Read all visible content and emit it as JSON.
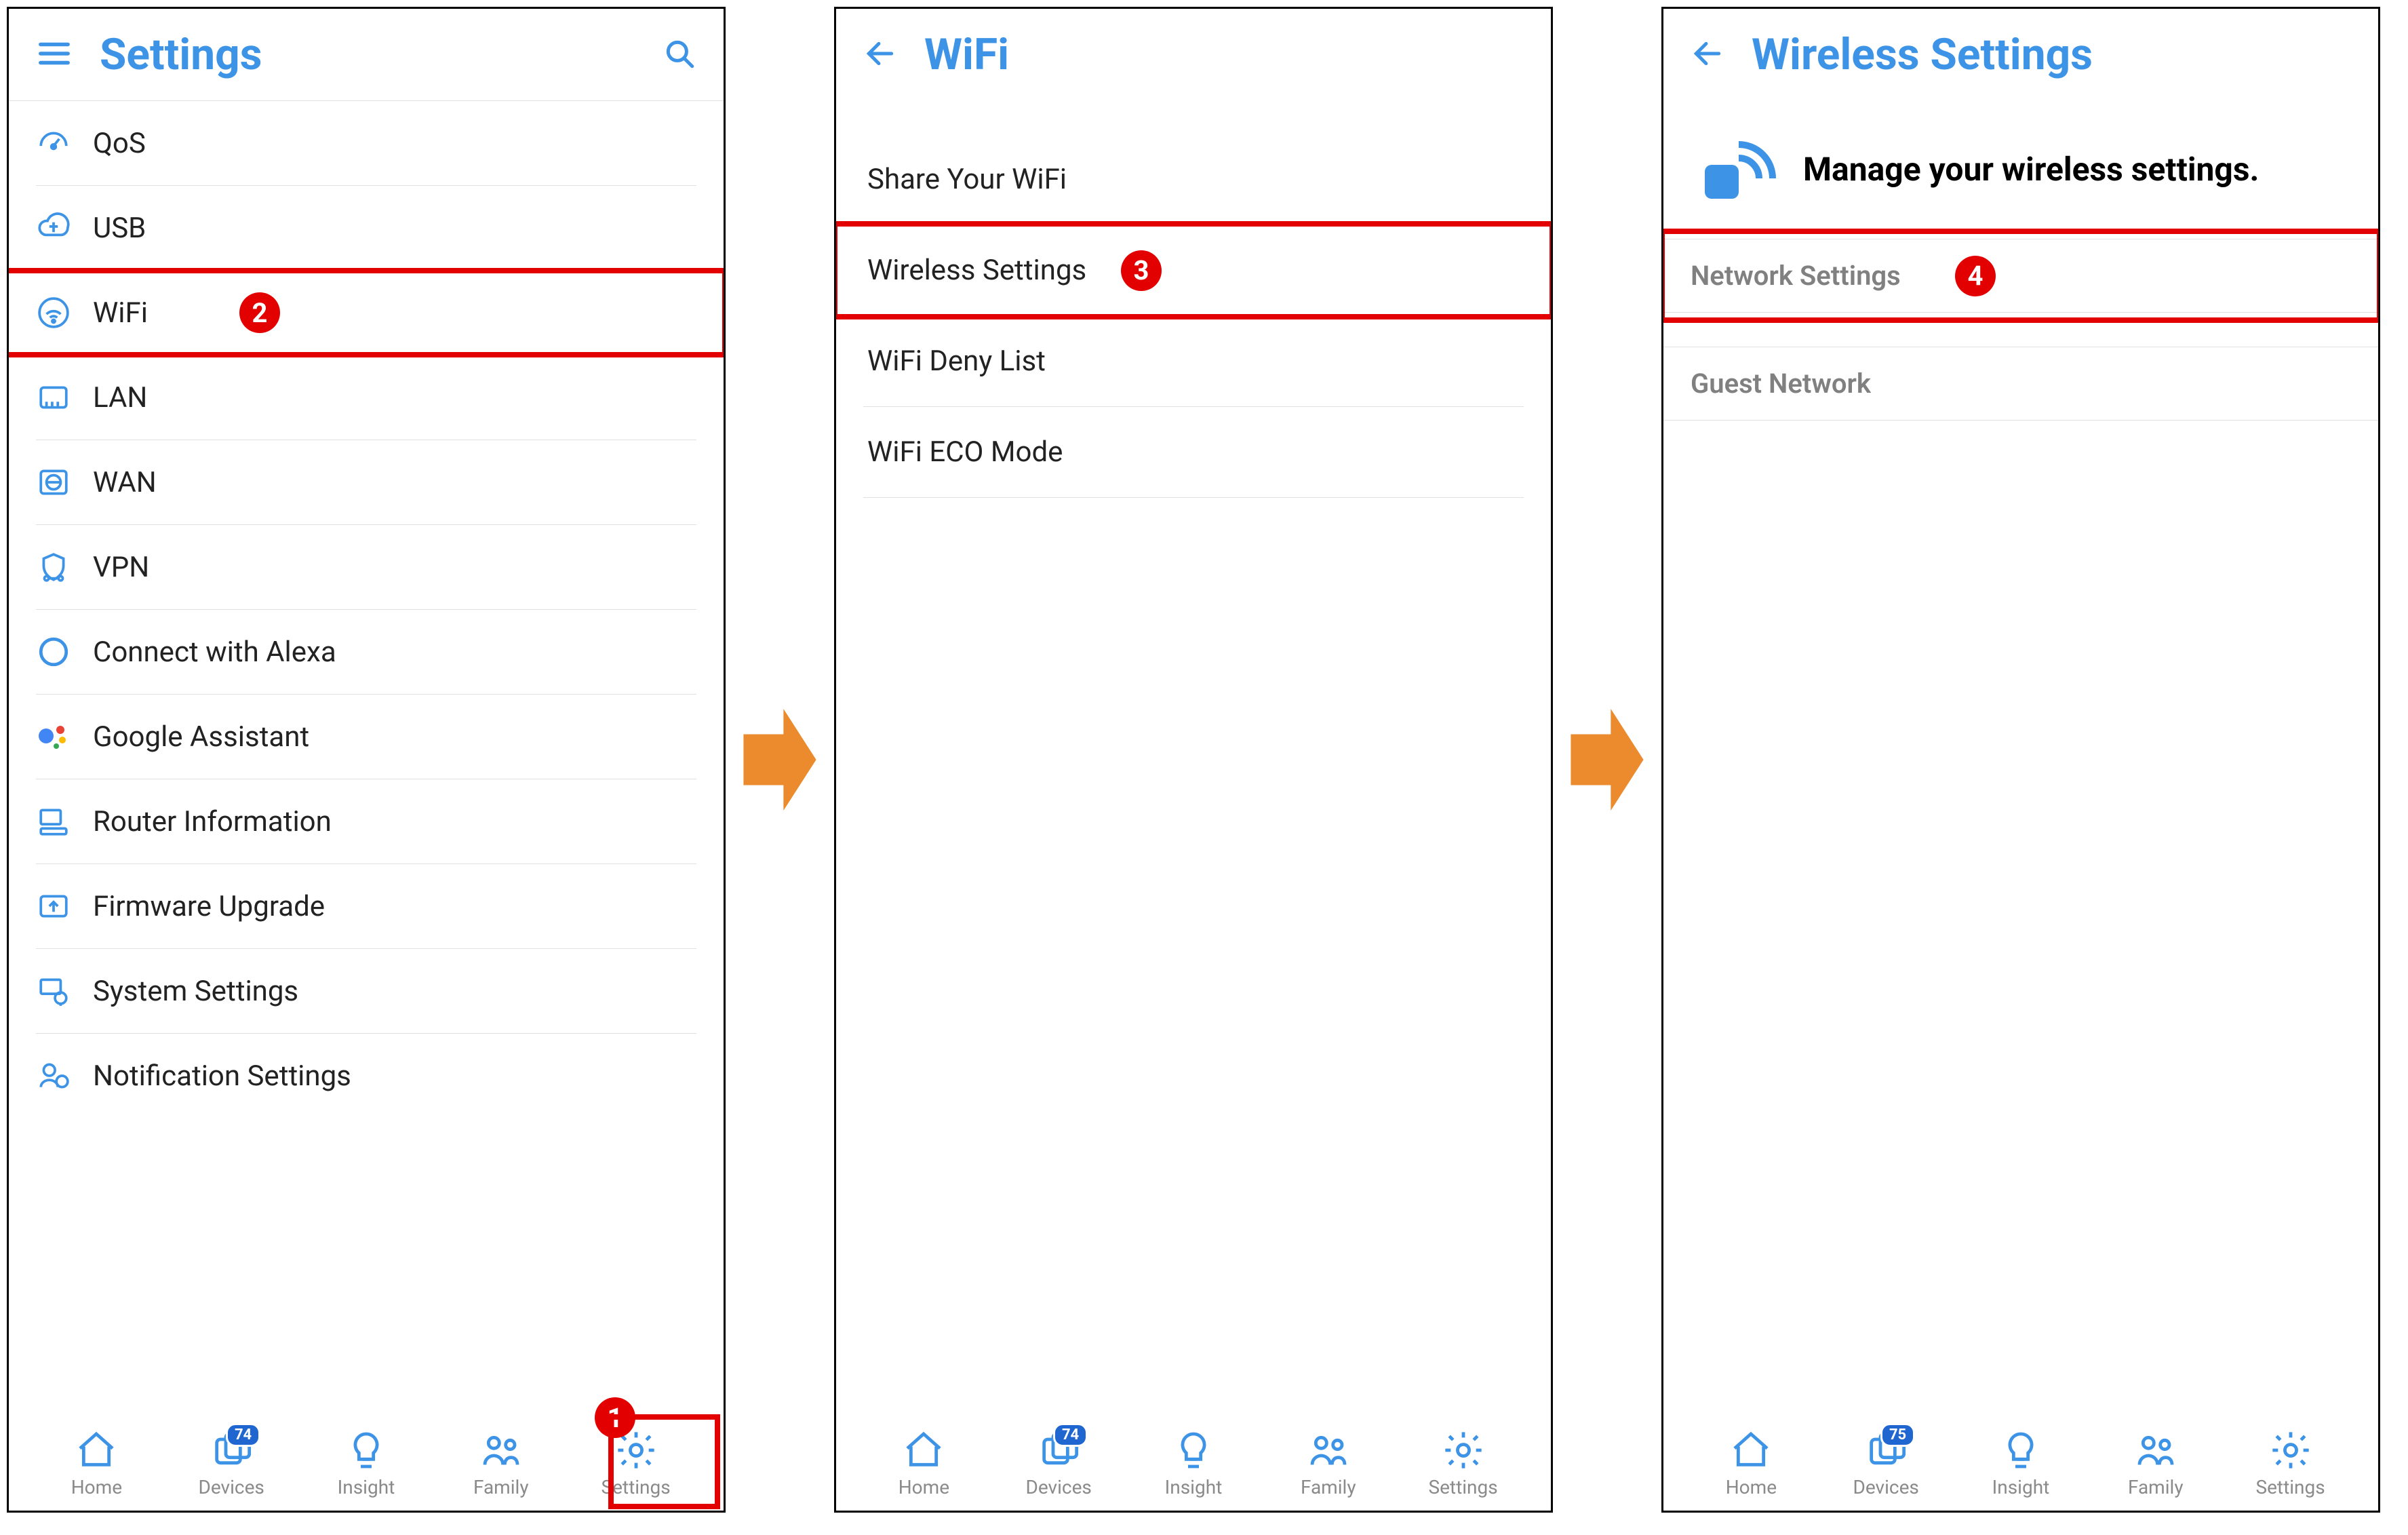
{
  "screen1": {
    "title": "Settings",
    "items": [
      {
        "label": "QoS"
      },
      {
        "label": "USB"
      },
      {
        "label": "WiFi"
      },
      {
        "label": "LAN"
      },
      {
        "label": "WAN"
      },
      {
        "label": "VPN"
      },
      {
        "label": "Connect with Alexa"
      },
      {
        "label": "Google Assistant"
      },
      {
        "label": "Router Information"
      },
      {
        "label": "Firmware Upgrade"
      },
      {
        "label": "System Settings"
      },
      {
        "label": "Notification Settings"
      }
    ],
    "devices_badge": "74",
    "callouts": {
      "settings_tab": "1",
      "wifi_row": "2"
    }
  },
  "screen2": {
    "title": "WiFi",
    "items": [
      {
        "label": "Share Your WiFi"
      },
      {
        "label": "Wireless Settings"
      },
      {
        "label": "WiFi Deny List"
      },
      {
        "label": "WiFi ECO Mode"
      }
    ],
    "devices_badge": "74",
    "callouts": {
      "wireless_settings": "3"
    }
  },
  "screen3": {
    "title": "Wireless Settings",
    "hero_text": "Manage your wireless settings.",
    "sections": [
      {
        "label": "Network Settings"
      },
      {
        "label": "Guest Network"
      }
    ],
    "devices_badge": "75",
    "callouts": {
      "network_settings": "4"
    }
  },
  "nav": {
    "home": "Home",
    "devices": "Devices",
    "insight": "Insight",
    "family": "Family",
    "settings": "Settings"
  }
}
